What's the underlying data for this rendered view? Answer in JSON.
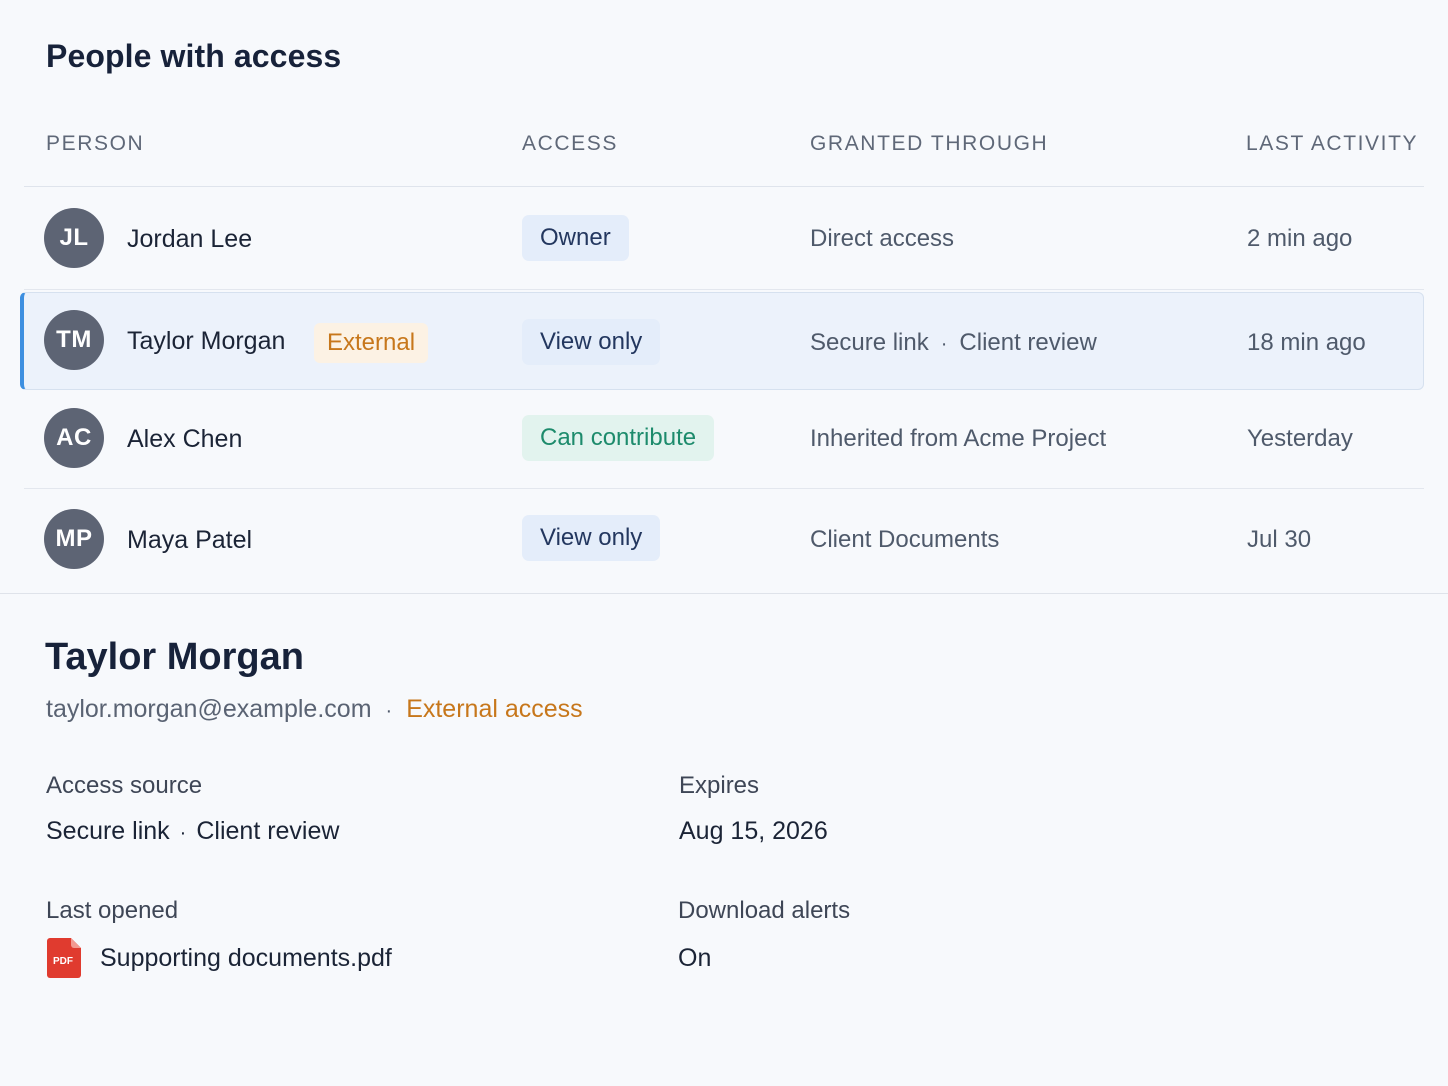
{
  "page": {
    "title": "People with access"
  },
  "table": {
    "headers": [
      "PERSON",
      "ACCESS",
      "GRANTED THROUGH",
      "LAST ACTIVITY"
    ],
    "rows": [
      {
        "initials": "JL",
        "name": "Jordan Lee",
        "badge": "",
        "access": "Owner",
        "access_type": "owner",
        "granted": "Direct access",
        "granted_detail": "",
        "last_activity": "2 min ago",
        "selected": false
      },
      {
        "initials": "TM",
        "name": "Taylor Morgan",
        "badge": "External",
        "access": "View only",
        "access_type": "view",
        "granted": "Secure link",
        "granted_detail": "Client review",
        "last_activity": "18 min ago",
        "selected": true
      },
      {
        "initials": "AC",
        "name": "Alex Chen",
        "badge": "",
        "access": "Can contribute",
        "access_type": "contribute",
        "granted": "Inherited from Acme Project",
        "granted_detail": "",
        "last_activity": "Yesterday",
        "selected": false
      },
      {
        "initials": "MP",
        "name": "Maya Patel",
        "badge": "",
        "access": "View only",
        "access_type": "view",
        "granted": "Client Documents",
        "granted_detail": "",
        "last_activity": "Jul 30",
        "selected": false
      }
    ]
  },
  "detail": {
    "name": "Taylor Morgan",
    "email": "taylor.morgan@example.com",
    "separator": "·",
    "access_note": "External access",
    "access_source_label": "Access source",
    "access_source_value": "Secure link",
    "access_source_detail": "Client review",
    "expires_label": "Expires",
    "expires_value": "Aug 15, 2026",
    "last_opened_label": "Last opened",
    "last_opened_file": "Supporting documents.pdf",
    "file_icon_text": "PDF",
    "download_alerts_label": "Download alerts",
    "download_alerts_value": "On"
  },
  "colors": {
    "accent": "#3d8fe0",
    "external": "#c7771b",
    "contribute": "#1d8b6c",
    "avatar": "#5d6474",
    "pdf": "#e03b2f"
  }
}
